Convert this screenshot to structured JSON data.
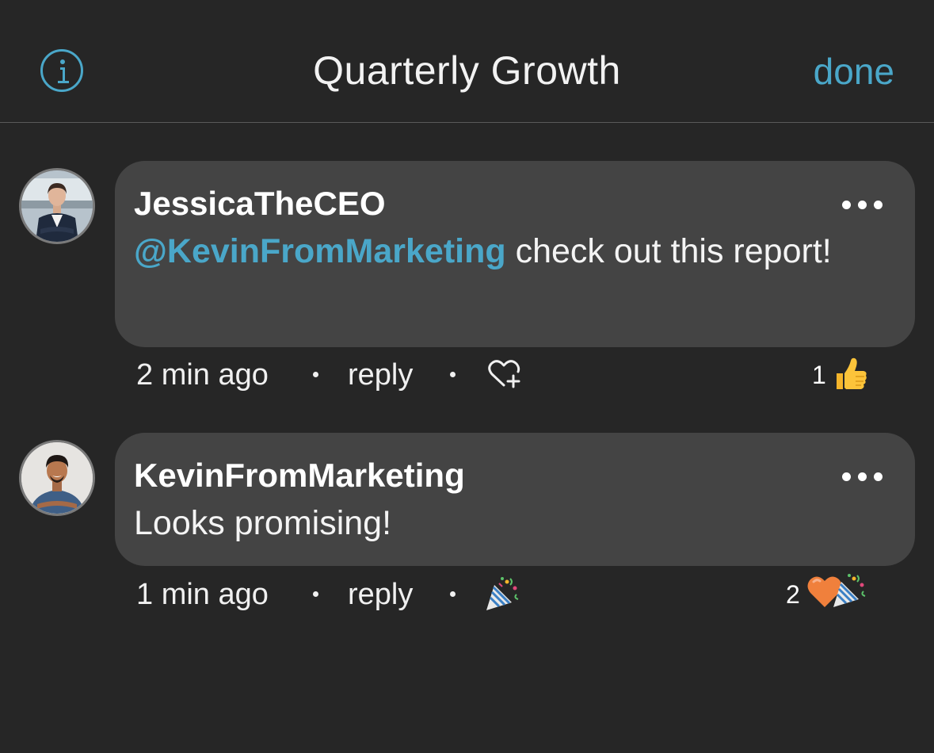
{
  "header": {
    "title": "Quarterly Growth",
    "done_label": "done",
    "info_icon": "info-icon",
    "accent_color": "#4aa7c9"
  },
  "comments": [
    {
      "author": "JessicaTheCEO",
      "mention": "@KevinFromMarketing",
      "text": " check out this report!",
      "time": "2 min ago",
      "reply_label": "reply",
      "reaction_action_icon": "heart-plus-icon",
      "reaction_count": "1",
      "reactions": [
        "thumbs-up-emoji"
      ]
    },
    {
      "author": "KevinFromMarketing",
      "mention": "",
      "text": "Looks promising!",
      "time": "1 min ago",
      "reply_label": "reply",
      "reaction_action_icon": "party-popper-icon",
      "reaction_count": "2",
      "reactions": [
        "orange-heart-emoji",
        "party-popper-emoji"
      ]
    }
  ]
}
